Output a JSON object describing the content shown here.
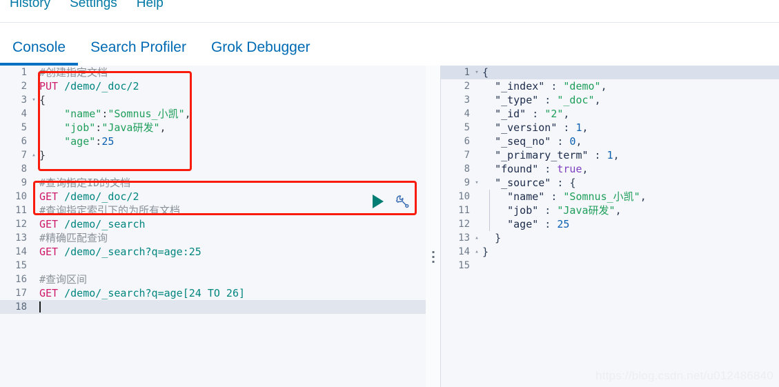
{
  "menubar": {
    "items": [
      {
        "label": "History"
      },
      {
        "label": "Settings"
      },
      {
        "label": "Help"
      }
    ]
  },
  "tabs": [
    {
      "label": "Console",
      "active": true
    },
    {
      "label": "Search Profiler",
      "active": false
    },
    {
      "label": "Grok Debugger",
      "active": false
    }
  ],
  "editor": {
    "lines": [
      {
        "no": "1",
        "fold": "",
        "text": "#创建指定文档"
      },
      {
        "no": "2",
        "fold": "",
        "text": "PUT /demo/_doc/2"
      },
      {
        "no": "3",
        "fold": "▾",
        "text": "{"
      },
      {
        "no": "4",
        "fold": "",
        "text": "    \"name\":\"Somnus_小凯\","
      },
      {
        "no": "5",
        "fold": "",
        "text": "    \"job\":\"Java研发\","
      },
      {
        "no": "6",
        "fold": "",
        "text": "    \"age\":25"
      },
      {
        "no": "7",
        "fold": "▴",
        "text": "}"
      },
      {
        "no": "8",
        "fold": "",
        "text": ""
      },
      {
        "no": "9",
        "fold": "",
        "text": "#查询指定ID的文档"
      },
      {
        "no": "10",
        "fold": "",
        "text": "GET /demo/_doc/2"
      },
      {
        "no": "11",
        "fold": "",
        "text": "#查询指定索引下的为所有文档"
      },
      {
        "no": "12",
        "fold": "",
        "text": "GET /demo/_search"
      },
      {
        "no": "13",
        "fold": "",
        "text": "#精确匹配查询"
      },
      {
        "no": "14",
        "fold": "",
        "text": "GET /demo/_search?q=age:25"
      },
      {
        "no": "15",
        "fold": "",
        "text": ""
      },
      {
        "no": "16",
        "fold": "",
        "text": "#查询区间"
      },
      {
        "no": "17",
        "fold": "",
        "text": "GET /demo/_search?q=age[24 TO 26]"
      },
      {
        "no": "18",
        "fold": "",
        "text": ""
      }
    ]
  },
  "output": {
    "lines": [
      {
        "no": "1",
        "fold": "▾",
        "text": "{"
      },
      {
        "no": "2",
        "fold": "",
        "text": "  \"_index\" : \"demo\","
      },
      {
        "no": "3",
        "fold": "",
        "text": "  \"_type\" : \"_doc\","
      },
      {
        "no": "4",
        "fold": "",
        "text": "  \"_id\" : \"2\","
      },
      {
        "no": "5",
        "fold": "",
        "text": "  \"_version\" : 1,"
      },
      {
        "no": "6",
        "fold": "",
        "text": "  \"_seq_no\" : 0,"
      },
      {
        "no": "7",
        "fold": "",
        "text": "  \"_primary_term\" : 1,"
      },
      {
        "no": "8",
        "fold": "",
        "text": "  \"found\" : true,"
      },
      {
        "no": "9",
        "fold": "▾",
        "text": "  \"_source\" : {"
      },
      {
        "no": "10",
        "fold": "",
        "text": "    \"name\" : \"Somnus_小凯\","
      },
      {
        "no": "11",
        "fold": "",
        "text": "    \"job\" : \"Java研发\","
      },
      {
        "no": "12",
        "fold": "",
        "text": "    \"age\" : 25"
      },
      {
        "no": "13",
        "fold": "▴",
        "text": "  }"
      },
      {
        "no": "14",
        "fold": "▴",
        "text": "}"
      },
      {
        "no": "15",
        "fold": "",
        "text": ""
      }
    ]
  },
  "actions": {
    "play_label": "play-request",
    "wrench_label": "request-options"
  },
  "watermark": {
    "text": "https://blog.csdn.net/u012486840"
  },
  "colors": {
    "accent": "#0071c2",
    "link": "#006bb4",
    "annotation": "#f91c0c",
    "play": "#017d73",
    "wrench": "#3c6eb4",
    "method": "#cf1a6b",
    "url": "#00857f",
    "string": "#1e9e5a",
    "number": "#0b5fb0",
    "boolean": "#7d3fc2",
    "comment": "#8a9199"
  }
}
